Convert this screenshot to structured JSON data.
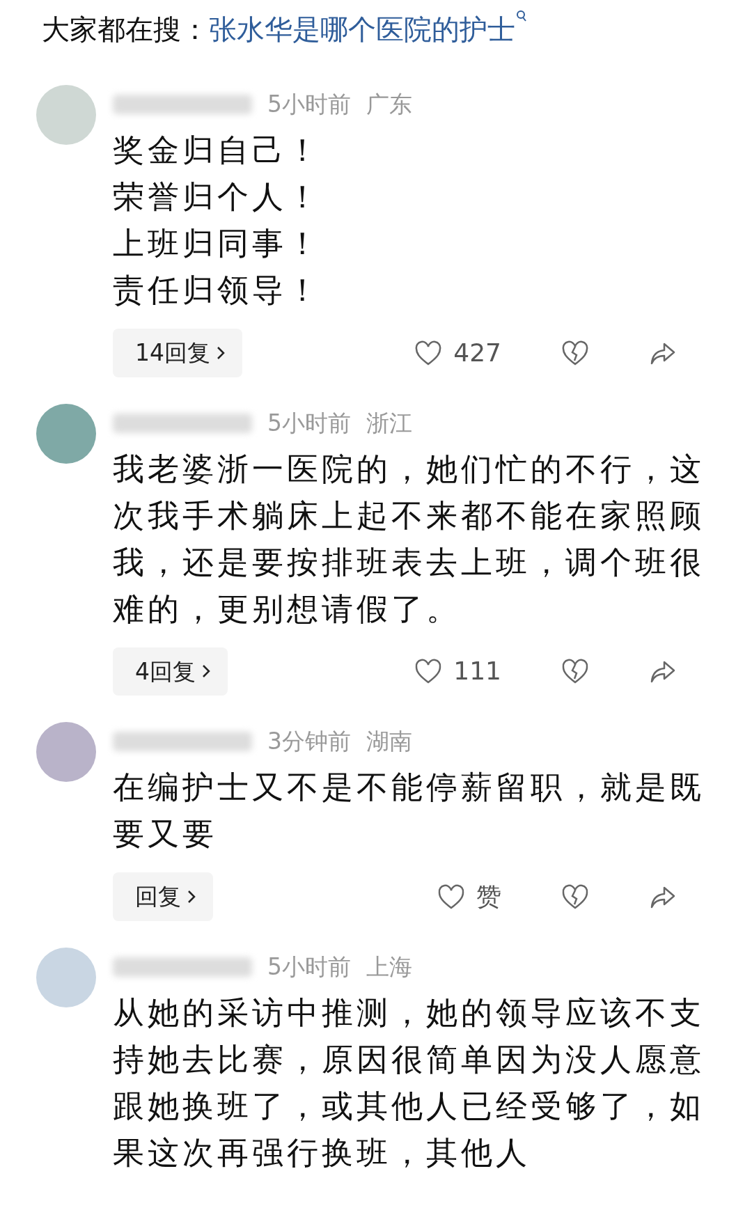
{
  "hot_search": {
    "label": "大家都在搜：",
    "query": "张水华是哪个医院的护士"
  },
  "comments": [
    {
      "time": "5小时前",
      "region": "广东",
      "text": [
        "奖金归自己！",
        "荣誉归个人！",
        "上班归同事！",
        "责任归领导！"
      ],
      "replies": "14回复",
      "likes": "427"
    },
    {
      "time": "5小时前",
      "region": "浙江",
      "text": [
        "我老婆浙一医院的，她们忙的不行，这次我手术躺床上起不来都不能在家照顾我，还是要按排班表去上班，调个班很难的，更别想请假了。"
      ],
      "replies": "4回复",
      "likes": "111"
    },
    {
      "time": "3分钟前",
      "region": "湖南",
      "text": [
        "在编护士又不是不能停薪留职，就是既要又要"
      ],
      "replies": "回复",
      "likes": "赞"
    },
    {
      "time": "5小时前",
      "region": "上海",
      "text": [
        "从她的采访中推测，她的领导应该不支持她去比赛，原因很简单因为没人愿意跟她换班了，或其他人已经受够了，如果这次再强行换班，其他人"
      ]
    }
  ]
}
